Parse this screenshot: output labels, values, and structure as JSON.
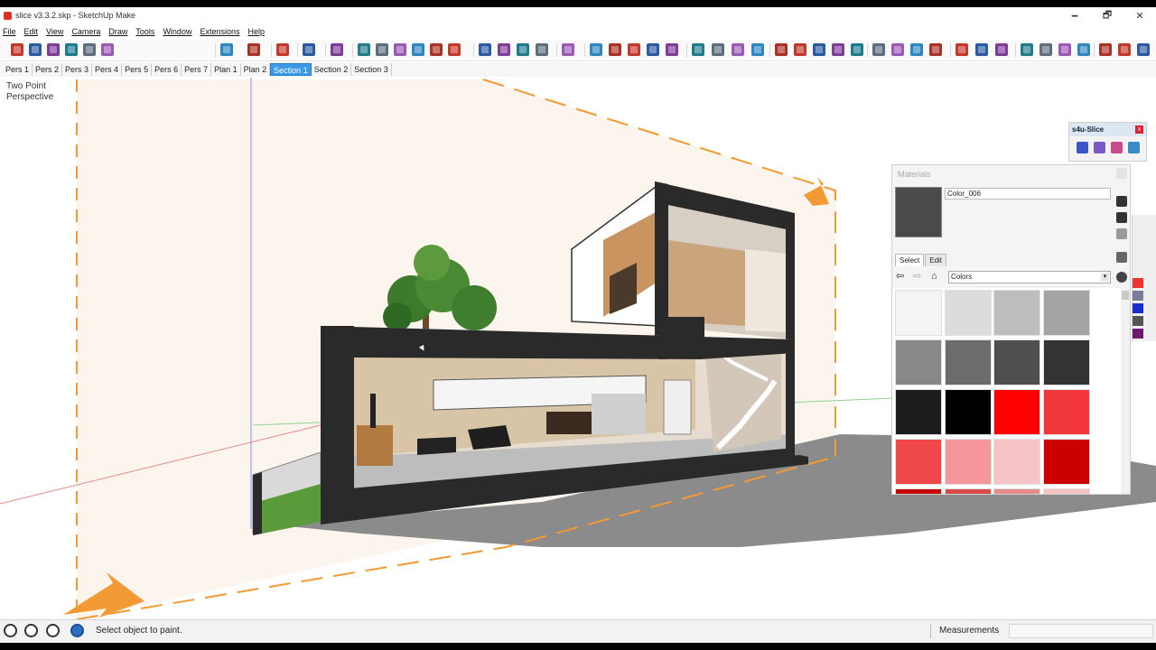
{
  "window": {
    "title": "slice v3.3.2.skp - SketchUp Make",
    "minimize": "🗕",
    "maximize": "🗗",
    "close": "✕"
  },
  "menu": [
    "File",
    "Edit",
    "View",
    "Camera",
    "Draw",
    "Tools",
    "Window",
    "Extensions",
    "Help"
  ],
  "scenes": [
    "Pers 1",
    "Pers 2",
    "Pers 3",
    "Pers 4",
    "Pers 5",
    "Pers 6",
    "Pers 7",
    "Plan 1",
    "Plan 2",
    "Section 1",
    "Section 2",
    "Section 3"
  ],
  "active_scene": "Section 1",
  "viewport": {
    "camera_label": "Two Point\nPerspective"
  },
  "slice_toolbar": {
    "title": "s4u-Slice",
    "close": "x"
  },
  "materials": {
    "title": "Materials",
    "current_material": "Color_006",
    "tabs": [
      "Select",
      "Edit"
    ],
    "active_tab": "Select",
    "library": "Colors",
    "nav_back": "⇦",
    "nav_forward": "⇨",
    "nav_home": "⌂",
    "select_arrow": "▾",
    "swatch_colors": [
      "#f4f4f4",
      "#dcdcdc",
      "#bdbdbd",
      "#a4a4a4",
      "#888888",
      "#6c6c6c",
      "#4f4f4f",
      "#333333",
      "#1c1c1c",
      "#000000",
      "#ff0000",
      "#f2373a",
      "#f0474b",
      "#f4969a",
      "#f6c4c6",
      "#cc0000"
    ]
  },
  "status": {
    "message": "Select object to paint.",
    "measurements_label": "Measurements",
    "measurements_value": ""
  },
  "colors": {
    "accent_orange": "#f29a34",
    "active_tab_blue": "#3c9be8",
    "material_swatch": "#4a4a4a"
  }
}
